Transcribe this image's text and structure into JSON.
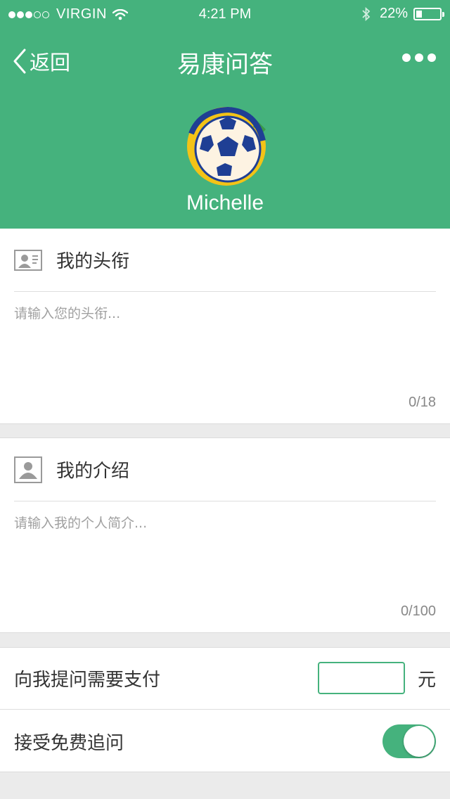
{
  "status_bar": {
    "carrier": "VIRGIN",
    "time": "4:21 PM",
    "battery": "22%",
    "signal_icon": "signal-dots-icon",
    "wifi_icon": "wifi-icon",
    "bluetooth_icon": "bluetooth-icon",
    "battery_icon": "battery-icon"
  },
  "nav": {
    "back_label": "返回",
    "title": "易康问答",
    "more_icon": "more-dots-icon"
  },
  "profile": {
    "name": "Michelle",
    "avatar_icon": "soccer-ball-avatar"
  },
  "title_section": {
    "heading": "我的头衔",
    "placeholder": "请输入您的头衔...",
    "value": "",
    "counter": "0/18",
    "icon": "id-card-icon"
  },
  "intro_section": {
    "heading": "我的介绍",
    "placeholder": "请输入我的个人简介...",
    "value": "",
    "counter": "0/100",
    "icon": "user-portrait-icon"
  },
  "settings": {
    "payment_label": "向我提问需要支付",
    "payment_value": "",
    "payment_unit": "元",
    "free_followup_label": "接受免费追问",
    "free_followup_enabled": true
  },
  "colors": {
    "accent": "#45b27d",
    "background": "#ebebeb"
  }
}
